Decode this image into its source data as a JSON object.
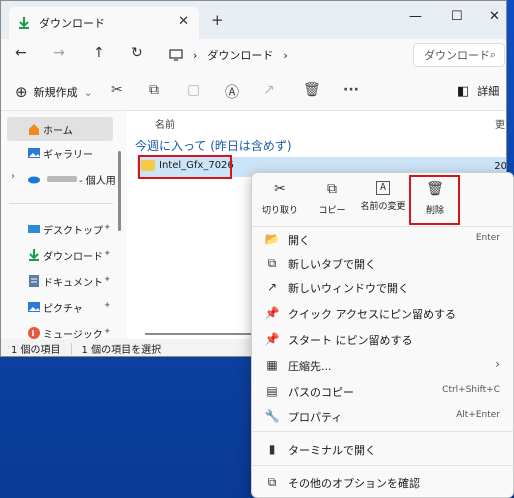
{
  "window": {
    "tab_title": "ダウンロード",
    "tab_close": "✕",
    "new_tab": "+",
    "minimize": "—",
    "maximize": "☐",
    "close": "✕"
  },
  "nav": {
    "back": "←",
    "forward": "→",
    "up": "↑",
    "refresh": "↻",
    "breadcrumb": [
      "ダウンロード"
    ],
    "chevron": "›",
    "search_placeholder": "ダウンロード"
  },
  "cmdbar": {
    "new_label": "新規作成",
    "new_chevron": "⌄",
    "more": "···",
    "details_label": "詳細"
  },
  "sidebar": {
    "items": [
      {
        "label": "ホーム",
        "pin": ""
      },
      {
        "label": "ギャラリー",
        "pin": ""
      },
      {
        "label": "- 個人用",
        "pin": ""
      },
      {
        "label": "デスクトップ",
        "pin": "📌"
      },
      {
        "label": "ダウンロード",
        "pin": "📌"
      },
      {
        "label": "ドキュメント",
        "pin": "📌"
      },
      {
        "label": "ピクチャ",
        "pin": "📌"
      },
      {
        "label": "ミュージック",
        "pin": "📌"
      }
    ]
  },
  "main": {
    "col_name": "名前",
    "col_date": "更",
    "group_label": "今週に入って (昨日は含めず)",
    "file_name": "Intel_Gfx_7026",
    "file_date": "20"
  },
  "status": {
    "count": "1 個の項目",
    "selected": "1 個の項目を選択"
  },
  "context": {
    "toolbar": [
      {
        "icon": "✂",
        "label": "切り取り"
      },
      {
        "icon": "⧉",
        "label": "コピー"
      },
      {
        "icon": "A",
        "label": "名前の変更"
      },
      {
        "icon": "🗑",
        "label": "削除"
      }
    ],
    "items": [
      {
        "icon": "📂",
        "label": "開く",
        "shortcut": "Enter"
      },
      {
        "icon": "⧉",
        "label": "新しいタブで開く",
        "shortcut": ""
      },
      {
        "icon": "↗",
        "label": "新しいウィンドウで開く",
        "shortcut": ""
      },
      {
        "icon": "📌",
        "label": "クイック アクセスにピン留めする",
        "shortcut": ""
      },
      {
        "icon": "📌",
        "label": "スタート にピン留めする",
        "shortcut": ""
      },
      {
        "icon": "▦",
        "label": "圧縮先...",
        "shortcut": "›"
      },
      {
        "icon": "▤",
        "label": "パスのコピー",
        "shortcut": "Ctrl+Shift+C"
      },
      {
        "icon": "🔧",
        "label": "プロパティ",
        "shortcut": "Alt+Enter"
      },
      {
        "icon": "▮",
        "label": "ターミナルで開く",
        "shortcut": ""
      },
      {
        "icon": "⧉",
        "label": "その他のオプションを確認",
        "shortcut": ""
      }
    ]
  }
}
